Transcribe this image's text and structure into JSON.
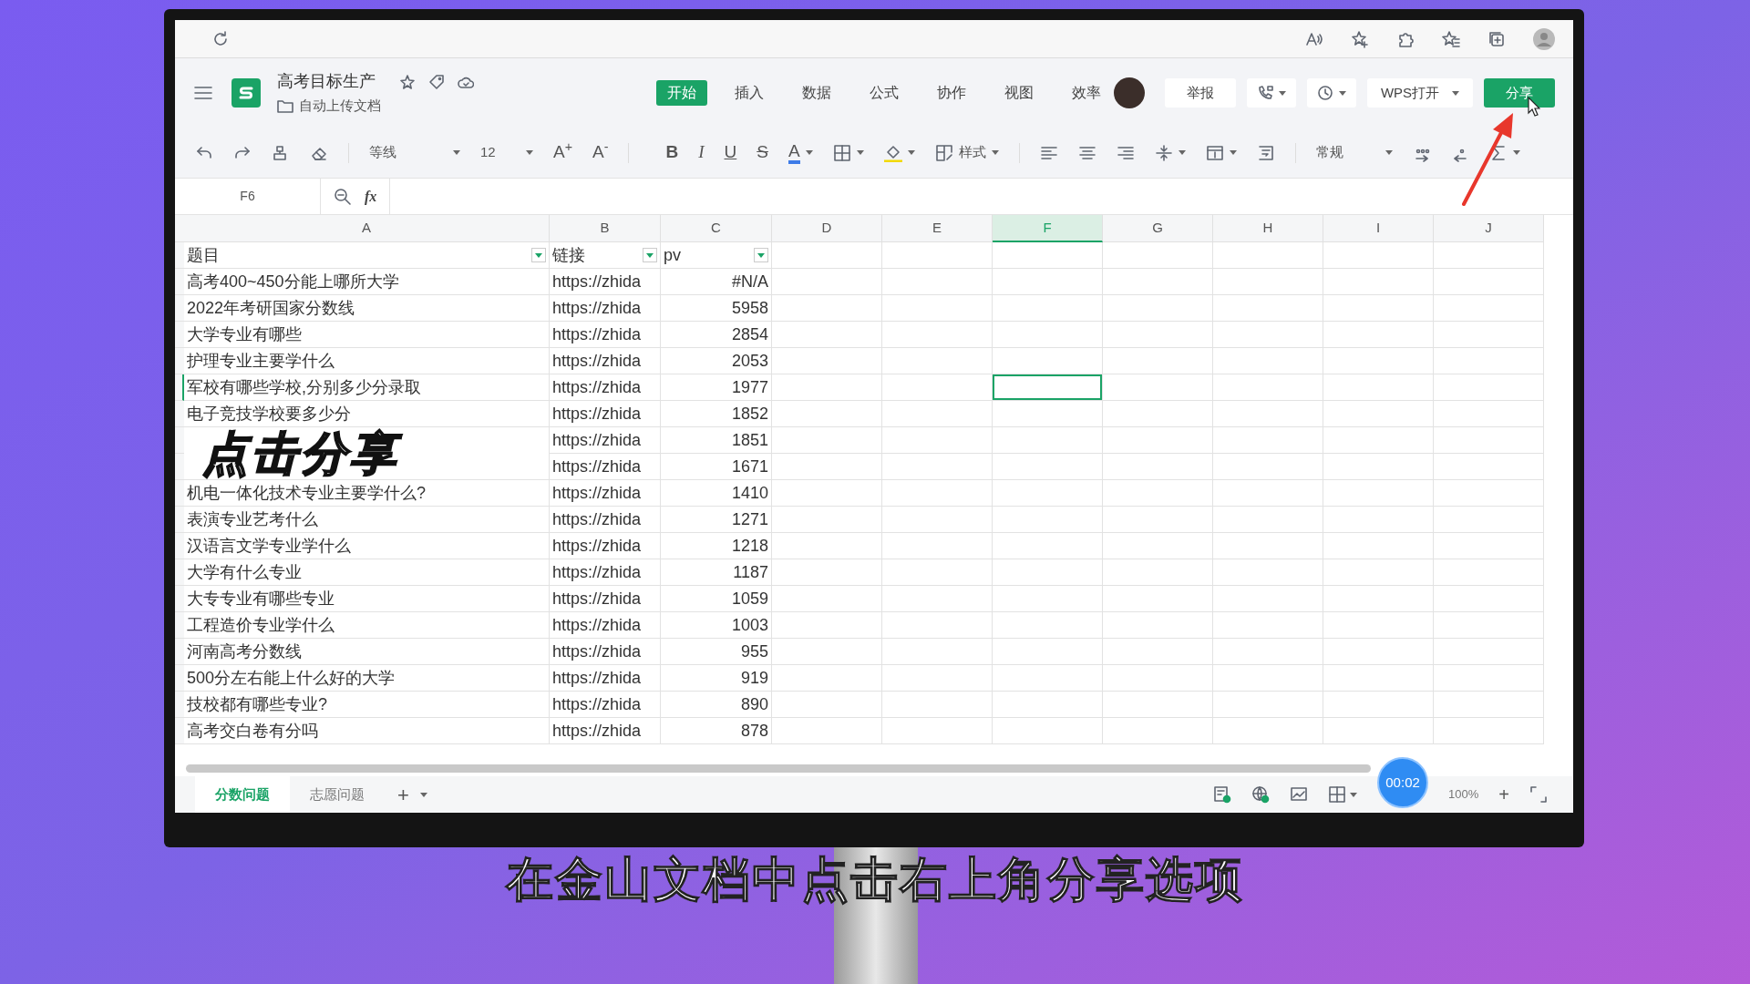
{
  "document": {
    "title": "高考目标生产",
    "folder": "自动上传文档"
  },
  "menu_tabs": [
    {
      "label": "开始",
      "selected": true
    },
    {
      "label": "插入",
      "selected": false
    },
    {
      "label": "数据",
      "selected": false
    },
    {
      "label": "公式",
      "selected": false
    },
    {
      "label": "协作",
      "selected": false
    },
    {
      "label": "视图",
      "selected": false
    },
    {
      "label": "效率",
      "selected": false
    }
  ],
  "header_buttons": {
    "report": "举报",
    "open_in_app": "WPS打开",
    "share": "分享"
  },
  "toolbar": {
    "font": "等线",
    "size": "12",
    "grow": "A$^{+}$",
    "shrink": "A$^{-}$",
    "bold": "B",
    "italic": "I",
    "underline": "U",
    "strike": "S",
    "font_color": "A",
    "style": "样式",
    "number_format": "常规"
  },
  "name_box": "F6",
  "formula_label": "fx",
  "columns": [
    {
      "label": "A",
      "selected": false
    },
    {
      "label": "B",
      "selected": false
    },
    {
      "label": "C",
      "selected": false
    },
    {
      "label": "D",
      "selected": false
    },
    {
      "label": "E",
      "selected": false
    },
    {
      "label": "F",
      "selected": true
    },
    {
      "label": "G",
      "selected": false
    },
    {
      "label": "H",
      "selected": false
    },
    {
      "label": "I",
      "selected": false
    },
    {
      "label": "J",
      "selected": false
    }
  ],
  "header_row": [
    "题目",
    "链接",
    "pv"
  ],
  "rows": [
    {
      "title": "高考400~450分能上哪所大学",
      "link": "https://zhida",
      "pv": "#N/A",
      "selected": false
    },
    {
      "title": "2022年考研国家分数线",
      "link": "https://zhida",
      "pv": "5958",
      "selected": false
    },
    {
      "title": "大学专业有哪些",
      "link": "https://zhida",
      "pv": "2854",
      "selected": false
    },
    {
      "title": "护理专业主要学什么",
      "link": "https://zhida",
      "pv": "2053",
      "selected": false
    },
    {
      "title": "军校有哪些学校,分别多少分录取",
      "link": "https://zhida",
      "pv": "1977",
      "selected": true
    },
    {
      "title": "电子竞技学校要多少分",
      "link": "https://zhida",
      "pv": "1852",
      "selected": false
    },
    {
      "link": "https://zhida",
      "pv": "1851",
      "selected": false
    },
    {
      "link": "https://zhida",
      "pv": "1671",
      "selected": false
    },
    {
      "title": "机电一体化技术专业主要学什么?",
      "link": "https://zhida",
      "pv": "1410",
      "selected": false
    },
    {
      "title": "表演专业艺考什么",
      "link": "https://zhida",
      "pv": "1271",
      "selected": false
    },
    {
      "title": "汉语言文学专业学什么",
      "link": "https://zhida",
      "pv": "1218",
      "selected": false
    },
    {
      "title": "大学有什么专业",
      "link": "https://zhida",
      "pv": "1187",
      "selected": false
    },
    {
      "title": "大专专业有哪些专业",
      "link": "https://zhida",
      "pv": "1059",
      "selected": false
    },
    {
      "title": "工程造价专业学什么",
      "link": "https://zhida",
      "pv": "1003",
      "selected": false
    },
    {
      "title": "河南高考分数线",
      "link": "https://zhida",
      "pv": "955",
      "selected": false
    },
    {
      "title": "500分左右能上什么好的大学",
      "link": "https://zhida",
      "pv": "919",
      "selected": false
    },
    {
      "title": "技校都有哪些专业?",
      "link": "https://zhida",
      "pv": "890",
      "selected": false
    },
    {
      "title": "高考交白卷有分吗",
      "link": "https://zhida",
      "pv": "878",
      "selected": false
    }
  ],
  "overlay_text": "点击分享",
  "sheet_tabs": [
    {
      "label": "分数问题",
      "selected": true
    },
    {
      "label": "志愿问题",
      "selected": false
    }
  ],
  "add_sheet": "+",
  "status": {
    "zoom": "100%",
    "zoom_in": "+",
    "timer": "00:02"
  },
  "caption": "在金山文档中点击右上角分享选项"
}
